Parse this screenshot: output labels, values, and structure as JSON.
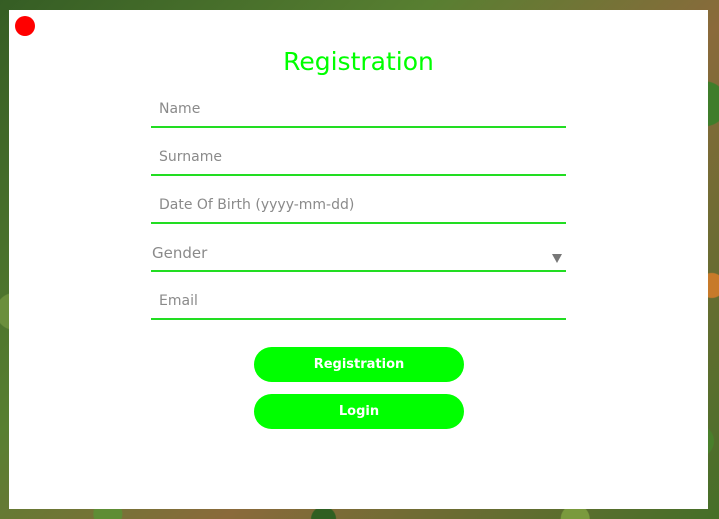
{
  "form": {
    "title": "Registration",
    "fields": [
      {
        "placeholder": "Name",
        "value": ""
      },
      {
        "placeholder": "Surname",
        "value": ""
      },
      {
        "placeholder": "Date Of Birth (yyyy-mm-dd)",
        "value": ""
      },
      {
        "placeholder": "Email",
        "value": ""
      }
    ],
    "gender": {
      "selected": "Gender"
    },
    "buttons": {
      "register_label": "Registration",
      "login_label": "Login"
    }
  },
  "colors": {
    "accent": "#00ff00",
    "underline": "#22dd22",
    "close": "#ff0000",
    "placeholder": "#8a8a8a"
  },
  "icons": {
    "close": "close-dot-icon",
    "dropdown": "chevron-down-icon"
  }
}
